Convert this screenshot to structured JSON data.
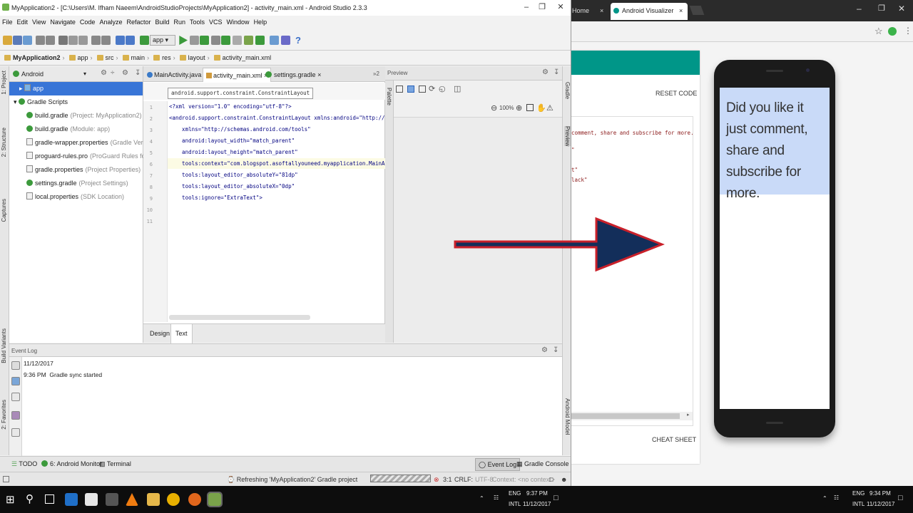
{
  "studio": {
    "title": "MyApplication2 - [C:\\Users\\M. Ifham Naeem\\AndroidStudioProjects\\MyApplication2] - activity_main.xml - Android Studio 2.3.3",
    "menu": [
      "File",
      "Edit",
      "View",
      "Navigate",
      "Code",
      "Analyze",
      "Refactor",
      "Build",
      "Run",
      "Tools",
      "VCS",
      "Window",
      "Help"
    ],
    "run_config": "app",
    "breadcrumbs": [
      "MyApplication2",
      "app",
      "src",
      "main",
      "res",
      "layout",
      "activity_main.xml"
    ],
    "left_strip": [
      "1: Project",
      "2: Structure",
      "Captures",
      "Build Variants",
      "2: Favorites"
    ],
    "right_strip": [
      "Gradle",
      "Preview",
      "Android Model"
    ],
    "project": {
      "view": "Android",
      "items": [
        {
          "label": "app",
          "hint": ""
        },
        {
          "label": "Gradle Scripts",
          "hint": ""
        },
        {
          "label": "build.gradle",
          "hint": "(Project: MyApplication2)"
        },
        {
          "label": "build.gradle",
          "hint": "(Module: app)"
        },
        {
          "label": "gradle-wrapper.properties",
          "hint": "(Gradle Version)"
        },
        {
          "label": "proguard-rules.pro",
          "hint": "(ProGuard Rules for app)"
        },
        {
          "label": "gradle.properties",
          "hint": "(Project Properties)"
        },
        {
          "label": "settings.gradle",
          "hint": "(Project Settings)"
        },
        {
          "label": "local.properties",
          "hint": "(SDK Location)"
        }
      ]
    },
    "tabs": [
      "MainActivity.java",
      "activity_main.xml",
      "settings.gradle"
    ],
    "tabs_more": "»2",
    "xml_crumb": "android.support.constraint.ConstraintLayout",
    "code_lines": [
      "<?xml version=\"1.0\" encoding=\"utf-8\"?>",
      "<android.support.constraint.ConstraintLayout xmlns:android=\"http://schemas",
      "    xmlns=\"http://schemas.android.com/tools\"",
      "    android:layout_width=\"match_parent\"",
      "    android:layout_height=\"match_parent\"",
      "    tools:context=\"com.blogspot.asoftallyouneed.myapplication.MainActivity",
      "    tools:layout_editor_absoluteY=\"81dp\"",
      "    tools:layout_editor_absoluteX=\"0dp\"",
      "    tools:ignore=\"ExtraText\">",
      "",
      ""
    ],
    "line_numbers": [
      "1",
      "2",
      "3",
      "4",
      "5",
      "6",
      "7",
      "8",
      "9",
      "10",
      "11"
    ],
    "editor_bottom_tabs": [
      "Design",
      "Text"
    ],
    "preview_title": "Preview",
    "palette_label": "Palette",
    "zoom": "100%",
    "event_log": {
      "title": "Event Log",
      "date": "11/12/2017",
      "time": "9:36 PM",
      "message": "Gradle sync started"
    },
    "tool_windows": [
      "TODO",
      "6: Android Monitor",
      "Terminal",
      "Event Log",
      "Gradle Console"
    ],
    "status": {
      "message": "Refreshing 'MyApplication2' Gradle project",
      "position": "3:1",
      "line_sep": "CRLF:",
      "encoding": "UTF-8",
      "context": "Context: <no context>"
    }
  },
  "browser": {
    "tabs": [
      "Home",
      "Android Visualizer"
    ],
    "reset_label": "RESET CODE",
    "cheat_label": "CHEAT SHEET",
    "code_snippets": [
      "comment, share and subscribe for more.\"",
      "\"",
      "t\"",
      "lack\""
    ],
    "phone_text": "Did you like it just comment, share and subscribe for more.",
    "accent": "#009688",
    "phone_highlight": "#c9daf8"
  },
  "taskbar": {
    "left": {
      "lang1": "ENG",
      "lang2": "INTL",
      "time": "9:37 PM",
      "date": "11/12/2017"
    },
    "right": {
      "lang1": "ENG",
      "lang2": "INTL",
      "time": "9:34 PM",
      "date": "11/12/2017"
    }
  }
}
